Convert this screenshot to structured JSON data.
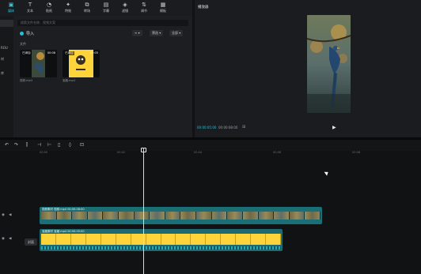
{
  "toolbar": {
    "items": [
      {
        "label": "媒体",
        "icon": "media-icon"
      },
      {
        "label": "文本",
        "icon": "text-icon"
      },
      {
        "label": "贴纸",
        "icon": "sticker-icon"
      },
      {
        "label": "特效",
        "icon": "effect-icon"
      },
      {
        "label": "转场",
        "icon": "transition-icon"
      },
      {
        "label": "字幕",
        "icon": "caption-icon"
      },
      {
        "label": "滤镜",
        "icon": "filter-icon"
      },
      {
        "label": "调节",
        "icon": "adjust-icon"
      },
      {
        "label": "模板",
        "icon": "template-icon"
      }
    ]
  },
  "sidebar": {
    "items": [
      "",
      "",
      "ROU",
      "材",
      "库"
    ]
  },
  "media": {
    "search_placeholder": "搜索文件名称、视频文案",
    "import_label": "导入",
    "btn_view": "≡ ▾",
    "btn_filter": "筛选 ▾",
    "btn_all": "全部 ▾",
    "section_label": "文件",
    "clips": [
      {
        "tag": "已添加",
        "duration": "00:08",
        "name": "视频.mp4"
      },
      {
        "tag": "已添加",
        "duration": "00:05",
        "name": "宝藏.mp4"
      }
    ]
  },
  "player": {
    "title": "播放器",
    "timecode_current": "00:00:05:00",
    "timecode_total": "00:00:08:00",
    "play_label": "▶"
  },
  "timeline": {
    "ruler": [
      "00:00",
      "00:02",
      "00:04",
      "00:06",
      "00:08"
    ],
    "track_bird_header": "视频素材  视频.mp4  00:00:08:00",
    "track_logo_header": "宝藏素材  宝藏.mp4  00:00:05:00",
    "cover_label": "封面"
  },
  "colors": {
    "accent": "#23c0d6",
    "clip_teal": "#1a6f76",
    "logo_yellow": "#ffd43b"
  }
}
